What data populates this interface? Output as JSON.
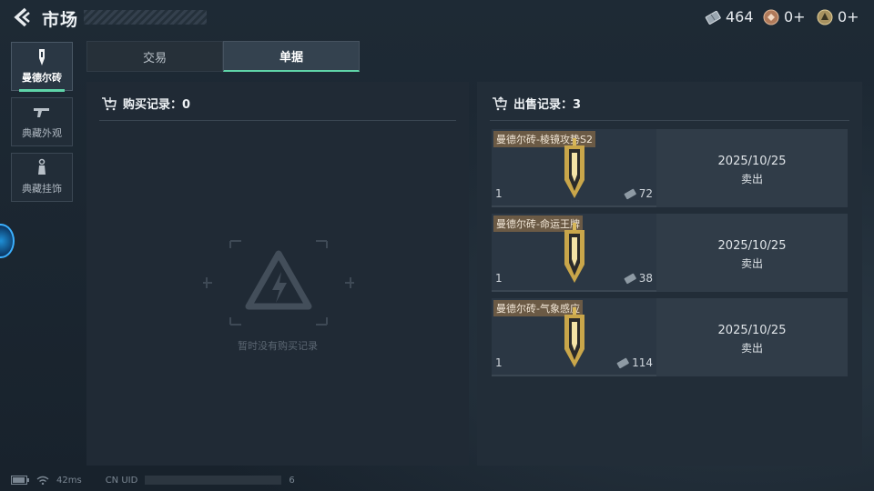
{
  "header": {
    "title": "市场",
    "currencies": [
      {
        "icon": "ticket-icon",
        "value": "464"
      },
      {
        "icon": "medal-icon",
        "value": "0+"
      },
      {
        "icon": "coin-icon",
        "value": "0+"
      }
    ]
  },
  "sidebar": {
    "items": [
      {
        "label": "曼德尔砖",
        "icon": "brick-icon",
        "active": true
      },
      {
        "label": "典藏外观",
        "icon": "gun-icon",
        "active": false
      },
      {
        "label": "典藏挂饰",
        "icon": "charm-icon",
        "active": false
      }
    ]
  },
  "tabs": [
    {
      "label": "交易",
      "active": false
    },
    {
      "label": "单据",
      "active": true
    }
  ],
  "purchase": {
    "title": "购买记录：0",
    "empty_text": "暂时没有购买记录"
  },
  "sales": {
    "title": "出售记录：3",
    "items": [
      {
        "name": "曼德尔砖-棱镜攻势S2",
        "qty": "1",
        "price": "72",
        "date": "2025/10/25",
        "status": "卖出"
      },
      {
        "name": "曼德尔砖-命运王牌",
        "qty": "1",
        "price": "38",
        "date": "2025/10/25",
        "status": "卖出"
      },
      {
        "name": "曼德尔砖-气象感应",
        "qty": "1",
        "price": "114",
        "date": "2025/10/25",
        "status": "卖出"
      }
    ]
  },
  "footer": {
    "ping": "42ms",
    "uid_label": "CN UID",
    "uid_tail": "6"
  },
  "colors": {
    "accent": "#5fd4a8",
    "name_tag": "#6b5a45",
    "panel": "#202a35"
  }
}
